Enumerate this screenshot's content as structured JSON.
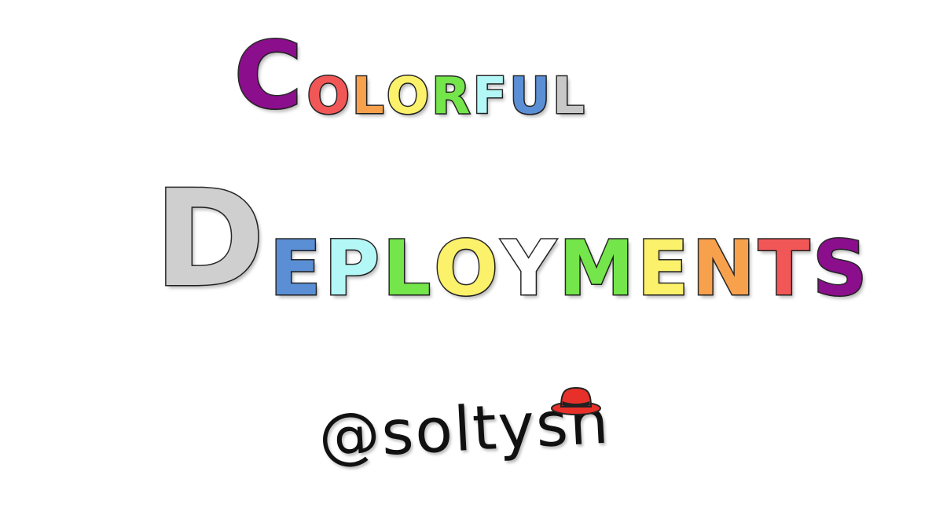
{
  "title": {
    "line1": {
      "letters": [
        {
          "char": "C",
          "color": "#8b0e8c",
          "big": true
        },
        {
          "char": "O",
          "color": "#f25757"
        },
        {
          "char": "L",
          "color": "#f7a14d"
        },
        {
          "char": "O",
          "color": "#fbf16a"
        },
        {
          "char": "R",
          "color": "#74e54a"
        },
        {
          "char": "F",
          "color": "#b4f7f7"
        },
        {
          "char": "U",
          "color": "#5a8fd6"
        },
        {
          "char": "L",
          "color": "#c8c8c8"
        }
      ]
    },
    "line2": {
      "letters": [
        {
          "char": "D",
          "color": "#cfcfcf",
          "big": true
        },
        {
          "char": "E",
          "color": "#5a8fd6"
        },
        {
          "char": "P",
          "color": "#b4f7f7"
        },
        {
          "char": "L",
          "color": "#74e54a"
        },
        {
          "char": "O",
          "color": "#fbf16a"
        },
        {
          "char": "Y",
          "color": "#ffffff"
        },
        {
          "char": "M",
          "color": "#74e54a"
        },
        {
          "char": "E",
          "color": "#fbf16a"
        },
        {
          "char": "N",
          "color": "#f7a14d"
        },
        {
          "char": "T",
          "color": "#f25757"
        },
        {
          "char": "S",
          "color": "#8b0e8c"
        }
      ]
    }
  },
  "author": {
    "handle": "@soltysh",
    "hat_icon": "red-fedora-hat",
    "hat_color": "#e8302a"
  }
}
